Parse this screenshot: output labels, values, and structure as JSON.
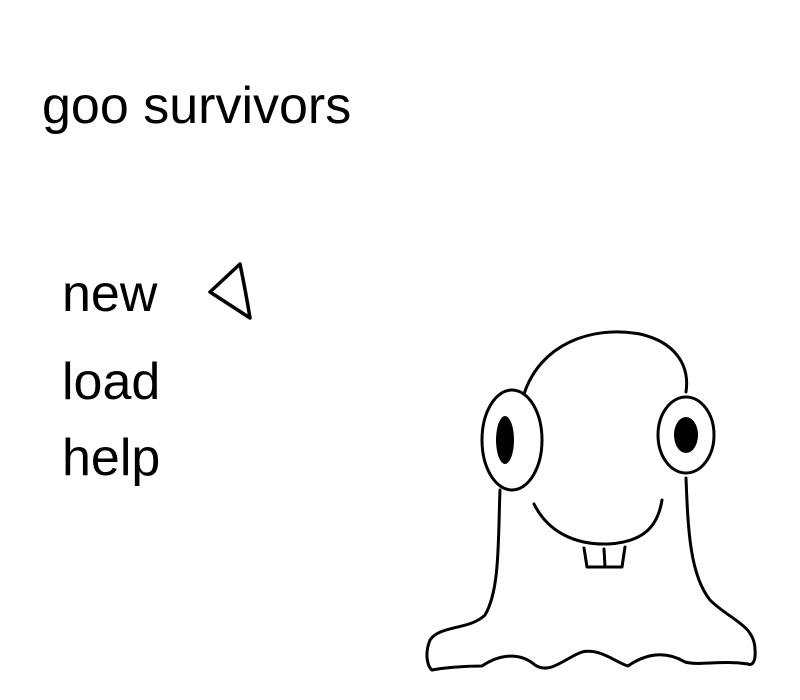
{
  "title": "goo survivors",
  "menu": {
    "items": [
      {
        "id": "new",
        "label": "new",
        "selected": true
      },
      {
        "id": "load",
        "label": "load",
        "selected": false
      },
      {
        "id": "help",
        "label": "help",
        "selected": false
      }
    ]
  },
  "colors": {
    "background": "#ffffff",
    "ink": "#000000"
  },
  "icons": {
    "selection_cursor": "left-pointing-triangle-icon",
    "mascot": "goo-blob-mascot"
  }
}
